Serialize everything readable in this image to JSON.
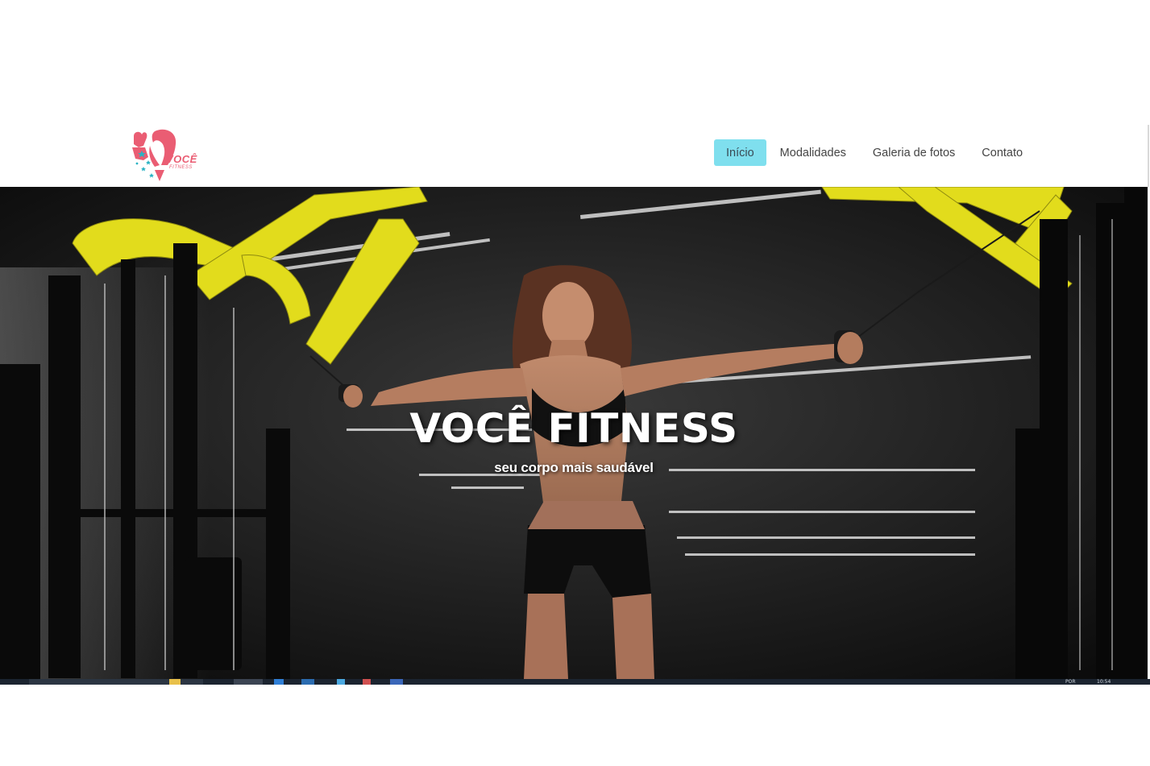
{
  "header": {
    "logo": {
      "text": "VOCÊ",
      "subtext": "FITNESS",
      "color": "#ea5d73",
      "accent": "#2bb3c4"
    },
    "nav": {
      "items": [
        {
          "label": "Início",
          "active": true
        },
        {
          "label": "Modalidades",
          "active": false
        },
        {
          "label": "Galeria de fotos",
          "active": false
        },
        {
          "label": "Contato",
          "active": false
        }
      ],
      "active_color": "#7fdfee"
    }
  },
  "hero": {
    "title": "VOCÊ FITNESS",
    "subtitle": "seu corpo mais saudável",
    "background_colors": {
      "dark": "#151515",
      "equipment_yellow": "#e8e020"
    }
  },
  "taskbar": {
    "language": "POR",
    "time": "10:54"
  }
}
